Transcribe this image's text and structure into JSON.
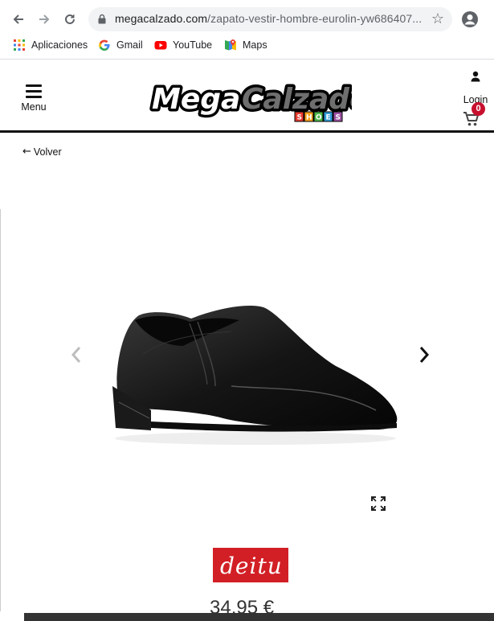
{
  "browser": {
    "url_domain": "megacalzado.com",
    "url_path": "/zapato-vestir-hombre-eurolin-yw686407...",
    "bookmarks": [
      {
        "label": "Aplicaciones",
        "icon": "apps-grid-icon"
      },
      {
        "label": "Gmail",
        "icon": "google-g-icon"
      },
      {
        "label": "YouTube",
        "icon": "youtube-icon"
      },
      {
        "label": "Maps",
        "icon": "maps-pin-icon"
      }
    ]
  },
  "header": {
    "menu_label": "Menu",
    "logo_text": "MegaCalzado",
    "logo_subtext": "SHOES",
    "login_label": "Login",
    "cart_count": "0"
  },
  "product": {
    "back_label": "Volver",
    "brand_label": "deitu",
    "price": "34,95 €"
  },
  "colors": {
    "brand_red": "#d21f26",
    "badge_red": "#c8102e",
    "text_dark": "#111111"
  }
}
